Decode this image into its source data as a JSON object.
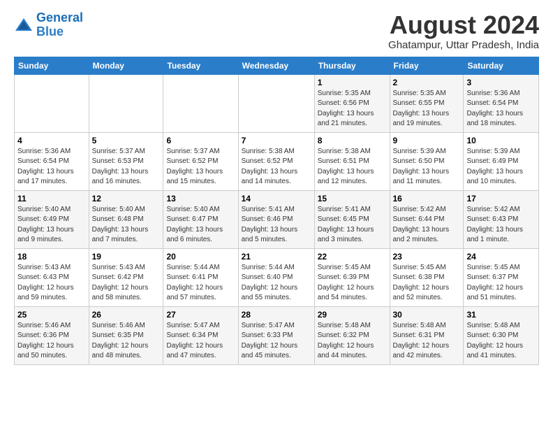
{
  "header": {
    "logo_line1": "General",
    "logo_line2": "Blue",
    "month": "August 2024",
    "location": "Ghatampur, Uttar Pradesh, India"
  },
  "days_of_week": [
    "Sunday",
    "Monday",
    "Tuesday",
    "Wednesday",
    "Thursday",
    "Friday",
    "Saturday"
  ],
  "weeks": [
    [
      {
        "num": "",
        "info": ""
      },
      {
        "num": "",
        "info": ""
      },
      {
        "num": "",
        "info": ""
      },
      {
        "num": "",
        "info": ""
      },
      {
        "num": "1",
        "info": "Sunrise: 5:35 AM\nSunset: 6:56 PM\nDaylight: 13 hours\nand 21 minutes."
      },
      {
        "num": "2",
        "info": "Sunrise: 5:35 AM\nSunset: 6:55 PM\nDaylight: 13 hours\nand 19 minutes."
      },
      {
        "num": "3",
        "info": "Sunrise: 5:36 AM\nSunset: 6:54 PM\nDaylight: 13 hours\nand 18 minutes."
      }
    ],
    [
      {
        "num": "4",
        "info": "Sunrise: 5:36 AM\nSunset: 6:54 PM\nDaylight: 13 hours\nand 17 minutes."
      },
      {
        "num": "5",
        "info": "Sunrise: 5:37 AM\nSunset: 6:53 PM\nDaylight: 13 hours\nand 16 minutes."
      },
      {
        "num": "6",
        "info": "Sunrise: 5:37 AM\nSunset: 6:52 PM\nDaylight: 13 hours\nand 15 minutes."
      },
      {
        "num": "7",
        "info": "Sunrise: 5:38 AM\nSunset: 6:52 PM\nDaylight: 13 hours\nand 14 minutes."
      },
      {
        "num": "8",
        "info": "Sunrise: 5:38 AM\nSunset: 6:51 PM\nDaylight: 13 hours\nand 12 minutes."
      },
      {
        "num": "9",
        "info": "Sunrise: 5:39 AM\nSunset: 6:50 PM\nDaylight: 13 hours\nand 11 minutes."
      },
      {
        "num": "10",
        "info": "Sunrise: 5:39 AM\nSunset: 6:49 PM\nDaylight: 13 hours\nand 10 minutes."
      }
    ],
    [
      {
        "num": "11",
        "info": "Sunrise: 5:40 AM\nSunset: 6:49 PM\nDaylight: 13 hours\nand 9 minutes."
      },
      {
        "num": "12",
        "info": "Sunrise: 5:40 AM\nSunset: 6:48 PM\nDaylight: 13 hours\nand 7 minutes."
      },
      {
        "num": "13",
        "info": "Sunrise: 5:40 AM\nSunset: 6:47 PM\nDaylight: 13 hours\nand 6 minutes."
      },
      {
        "num": "14",
        "info": "Sunrise: 5:41 AM\nSunset: 6:46 PM\nDaylight: 13 hours\nand 5 minutes."
      },
      {
        "num": "15",
        "info": "Sunrise: 5:41 AM\nSunset: 6:45 PM\nDaylight: 13 hours\nand 3 minutes."
      },
      {
        "num": "16",
        "info": "Sunrise: 5:42 AM\nSunset: 6:44 PM\nDaylight: 13 hours\nand 2 minutes."
      },
      {
        "num": "17",
        "info": "Sunrise: 5:42 AM\nSunset: 6:43 PM\nDaylight: 13 hours\nand 1 minute."
      }
    ],
    [
      {
        "num": "18",
        "info": "Sunrise: 5:43 AM\nSunset: 6:43 PM\nDaylight: 12 hours\nand 59 minutes."
      },
      {
        "num": "19",
        "info": "Sunrise: 5:43 AM\nSunset: 6:42 PM\nDaylight: 12 hours\nand 58 minutes."
      },
      {
        "num": "20",
        "info": "Sunrise: 5:44 AM\nSunset: 6:41 PM\nDaylight: 12 hours\nand 57 minutes."
      },
      {
        "num": "21",
        "info": "Sunrise: 5:44 AM\nSunset: 6:40 PM\nDaylight: 12 hours\nand 55 minutes."
      },
      {
        "num": "22",
        "info": "Sunrise: 5:45 AM\nSunset: 6:39 PM\nDaylight: 12 hours\nand 54 minutes."
      },
      {
        "num": "23",
        "info": "Sunrise: 5:45 AM\nSunset: 6:38 PM\nDaylight: 12 hours\nand 52 minutes."
      },
      {
        "num": "24",
        "info": "Sunrise: 5:45 AM\nSunset: 6:37 PM\nDaylight: 12 hours\nand 51 minutes."
      }
    ],
    [
      {
        "num": "25",
        "info": "Sunrise: 5:46 AM\nSunset: 6:36 PM\nDaylight: 12 hours\nand 50 minutes."
      },
      {
        "num": "26",
        "info": "Sunrise: 5:46 AM\nSunset: 6:35 PM\nDaylight: 12 hours\nand 48 minutes."
      },
      {
        "num": "27",
        "info": "Sunrise: 5:47 AM\nSunset: 6:34 PM\nDaylight: 12 hours\nand 47 minutes."
      },
      {
        "num": "28",
        "info": "Sunrise: 5:47 AM\nSunset: 6:33 PM\nDaylight: 12 hours\nand 45 minutes."
      },
      {
        "num": "29",
        "info": "Sunrise: 5:48 AM\nSunset: 6:32 PM\nDaylight: 12 hours\nand 44 minutes."
      },
      {
        "num": "30",
        "info": "Sunrise: 5:48 AM\nSunset: 6:31 PM\nDaylight: 12 hours\nand 42 minutes."
      },
      {
        "num": "31",
        "info": "Sunrise: 5:48 AM\nSunset: 6:30 PM\nDaylight: 12 hours\nand 41 minutes."
      }
    ]
  ]
}
